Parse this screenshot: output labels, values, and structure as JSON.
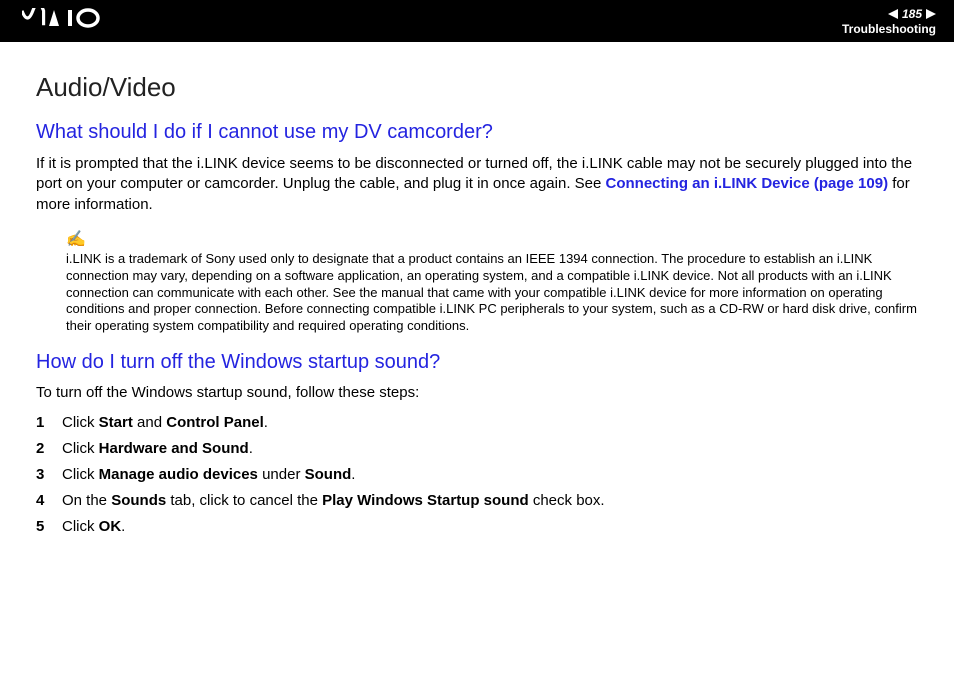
{
  "header": {
    "logo": "VAIO",
    "page_number": "185",
    "section": "Troubleshooting"
  },
  "page": {
    "title": "Audio/Video",
    "q1": {
      "heading": "What should I do if I cannot use my DV camcorder?",
      "body_a": "If it is prompted that the i.LINK device seems to be disconnected or turned off, the i.LINK cable may not be securely plugged into the port on your computer or camcorder. Unplug the cable, and plug it in once again. See ",
      "link": "Connecting an i.LINK Device (page 109)",
      "body_b": " for more information.",
      "note": "i.LINK is a trademark of Sony used only to designate that a product contains an IEEE 1394 connection. The procedure to establish an i.LINK connection may vary, depending on a software application, an operating system, and a compatible i.LINK device. Not all products with an i.LINK connection can communicate with each other. See the manual that came with your compatible i.LINK device for more information on operating conditions and proper connection. Before connecting compatible i.LINK PC peripherals to your system, such as a CD-RW or hard disk drive, confirm their operating system compatibility and required operating conditions."
    },
    "q2": {
      "heading": "How do I turn off the Windows startup sound?",
      "intro": "To turn off the Windows startup sound, follow these steps:",
      "steps": {
        "s1a": "Click ",
        "s1b": "Start",
        "s1c": " and ",
        "s1d": "Control Panel",
        "s1e": ".",
        "s2a": "Click ",
        "s2b": "Hardware and Sound",
        "s2c": ".",
        "s3a": "Click ",
        "s3b": "Manage audio devices",
        "s3c": " under ",
        "s3d": "Sound",
        "s3e": ".",
        "s4a": "On the ",
        "s4b": "Sounds",
        "s4c": " tab, click to cancel the ",
        "s4d": "Play Windows Startup sound",
        "s4e": " check box.",
        "s5a": "Click ",
        "s5b": "OK",
        "s5c": "."
      }
    }
  }
}
